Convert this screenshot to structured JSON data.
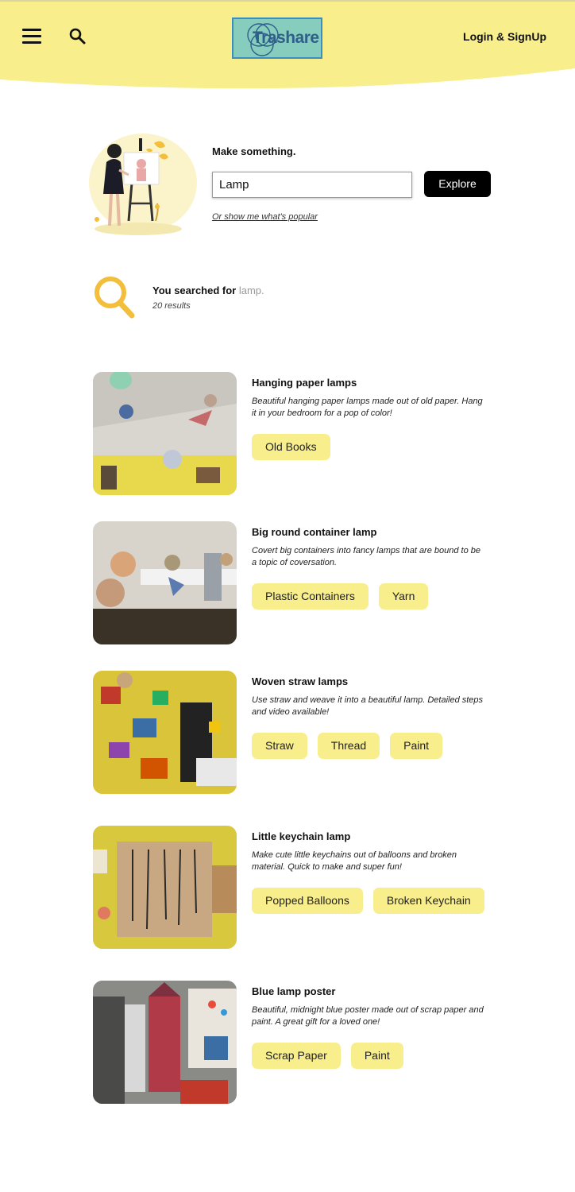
{
  "header": {
    "logo_text": "Trashare",
    "login_label": "Login & SignUp"
  },
  "hero": {
    "title": "Make something.",
    "search_value": "Lamp",
    "explore_label": "Explore",
    "popular_link": "Or show me what's popular"
  },
  "summary": {
    "prefix": "You searched for",
    "term": "lamp.",
    "count": "20 results"
  },
  "results": [
    {
      "title": "Hanging paper lamps",
      "description": "Beautiful hanging paper lamps made out of old paper. Hang it in your bedroom for a pop of color!",
      "tags": [
        "Old Books"
      ]
    },
    {
      "title": "Big round container lamp",
      "description": "Covert big containers into fancy lamps that are bound to be a topic of coversation.",
      "tags": [
        "Plastic Containers",
        "Yarn"
      ]
    },
    {
      "title": "Woven straw lamps",
      "description": "Use straw and weave it into a beautiful lamp. Detailed steps and video available!",
      "tags": [
        "Straw",
        "Thread",
        "Paint"
      ]
    },
    {
      "title": "Little keychain lamp",
      "description": "Make cute little keychains out of balloons and broken material. Quick to make and super fun!",
      "tags": [
        "Popped Balloons",
        "Broken Keychain"
      ]
    },
    {
      "title": "Blue lamp poster",
      "description": "Beautiful, midnight blue poster made out of scrap paper and paint. A great gift for a loved one!",
      "tags": [
        "Scrap Paper",
        "Paint"
      ]
    }
  ],
  "colors": {
    "header_bg": "#f8ee8b",
    "tag_bg": "#f8ee8b",
    "logo_bg": "#86cdbe",
    "accent_icon": "#f2be3c"
  },
  "icons": {
    "menu": "hamburger-menu-icon",
    "search": "search-icon",
    "results": "magnifier-icon"
  }
}
